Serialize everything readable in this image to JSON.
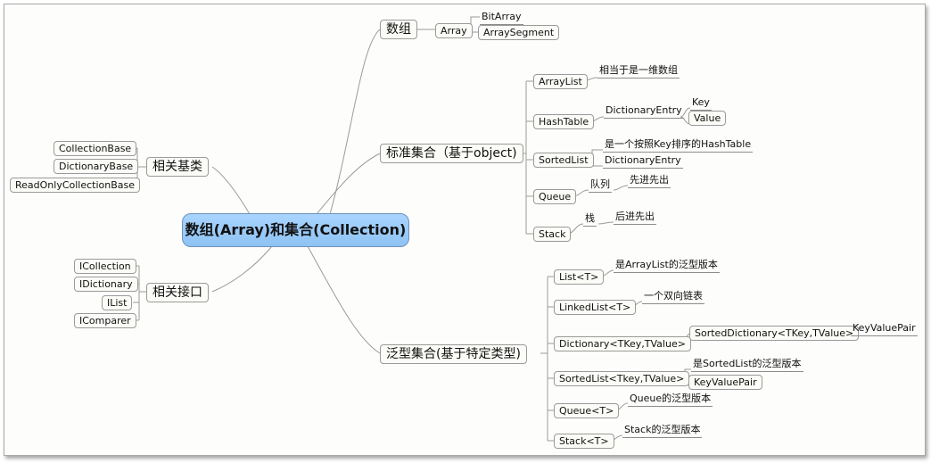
{
  "root": "数组(Array)和集合(Collection)",
  "array_group": {
    "label": "数组",
    "child": "Array",
    "subs": [
      "BitArray",
      "ArraySegment"
    ]
  },
  "standard_group": {
    "label": "标准集合（基于object)",
    "arraylist": {
      "label": "ArrayList",
      "note": "相当于是一维数组"
    },
    "hashtable": {
      "label": "HashTable",
      "entry": "DictionaryEntry",
      "key": "Key",
      "value": "Value"
    },
    "sortedlist": {
      "label": "SortedList",
      "note": "是一个按照Key排序的HashTable",
      "entry": "DictionaryEntry"
    },
    "queue": {
      "label": "Queue",
      "note1": "队列",
      "note2": "先进先出"
    },
    "stack": {
      "label": "Stack",
      "note1": "栈",
      "note2": "后进先出"
    }
  },
  "generic_group": {
    "label": "泛型集合(基于特定类型)",
    "list": {
      "label": "List<T>",
      "note": "是ArrayList的泛型版本"
    },
    "linkedlist": {
      "label": "LinkedList<T>",
      "note": "一个双向链表"
    },
    "dictionary": {
      "label": "Dictionary<TKey,TValue>",
      "sorted": "SortedDictionary<TKey,TValue>",
      "kvp": "KeyValuePair"
    },
    "sortedlist": {
      "label": "SortedList<Tkey,TValue>",
      "note": "是SortedList的泛型版本",
      "kvp": "KeyValuePair"
    },
    "queue": {
      "label": "Queue<T>",
      "note": "Queue的泛型版本"
    },
    "stack": {
      "label": "Stack<T>",
      "note": "Stack的泛型版本"
    }
  },
  "base_classes": {
    "label": "相关基类",
    "items": [
      "CollectionBase",
      "DictionaryBase",
      "ReadOnlyCollectionBase"
    ]
  },
  "interfaces": {
    "label": "相关接口",
    "items": [
      "ICollection",
      "IDictionary",
      "IList",
      "IComparer"
    ]
  }
}
